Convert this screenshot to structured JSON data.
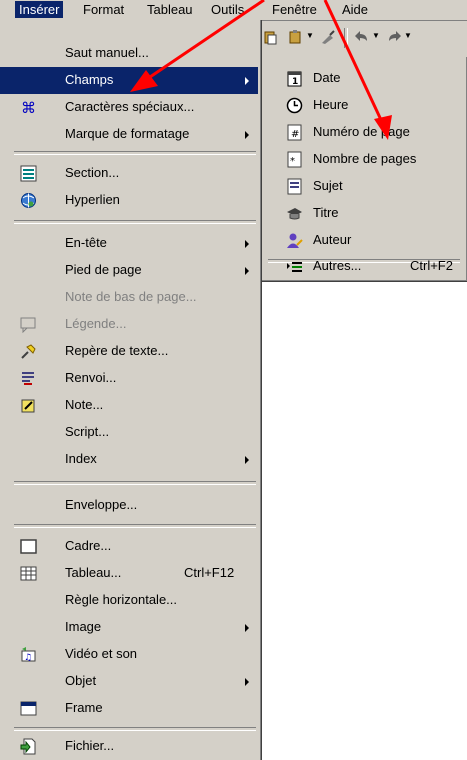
{
  "menubar": {
    "items": [
      "Insérer",
      "Format",
      "Tableau",
      "Outils",
      "Fenêtre",
      "Aide"
    ]
  },
  "main_menu": {
    "items": [
      {
        "label": "Saut manuel..."
      },
      {
        "label": "Champs"
      },
      {
        "label": "Caractères spéciaux..."
      },
      {
        "label": "Marque de formatage"
      },
      {
        "label": "Section..."
      },
      {
        "label": "Hyperlien"
      },
      {
        "label": "En-tête"
      },
      {
        "label": "Pied de page"
      },
      {
        "label": "Note de bas de page..."
      },
      {
        "label": "Légende..."
      },
      {
        "label": "Repère de texte..."
      },
      {
        "label": "Renvoi..."
      },
      {
        "label": "Note..."
      },
      {
        "label": "Script..."
      },
      {
        "label": "Index"
      },
      {
        "label": "Enveloppe..."
      },
      {
        "label": "Cadre..."
      },
      {
        "label": "Tableau...",
        "shortcut": "Ctrl+F12"
      },
      {
        "label": "Règle horizontale..."
      },
      {
        "label": "Image"
      },
      {
        "label": "Vidéo et son"
      },
      {
        "label": "Objet"
      },
      {
        "label": "Frame"
      },
      {
        "label": "Fichier..."
      }
    ]
  },
  "sub_menu": {
    "items": [
      {
        "label": "Date"
      },
      {
        "label": "Heure"
      },
      {
        "label": "Numéro de page"
      },
      {
        "label": "Nombre de pages"
      },
      {
        "label": "Sujet"
      },
      {
        "label": "Titre"
      },
      {
        "label": "Auteur"
      },
      {
        "label": "Autres...",
        "shortcut": "Ctrl+F2"
      }
    ]
  },
  "colors": {
    "menu_bg": "#d4d0c8",
    "highlight": "#0a246a",
    "annotation_arrow": "#ff0000",
    "disabled_text": "#808080"
  }
}
